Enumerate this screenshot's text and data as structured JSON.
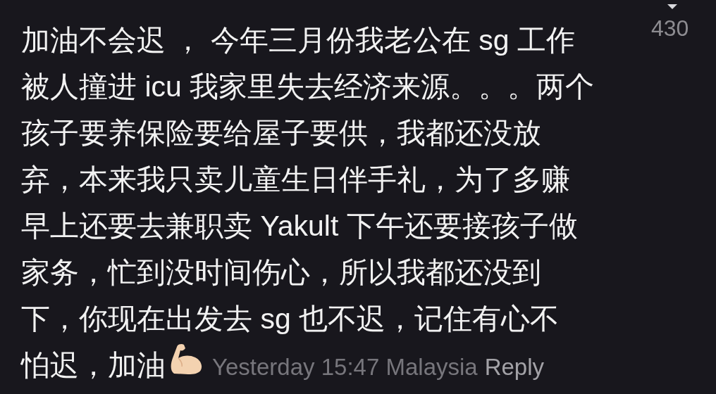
{
  "comment": {
    "lines": [
      "加油不会迟 ， 今年三月份我老公在 sg 工作",
      "被人撞进 icu 我家里失去经济来源。。。两个",
      "孩子要养保险要给屋子要供，我都还没放",
      "弃，本来我只卖儿童生日伴手礼，为了多赚",
      "早上还要去兼职卖 Yakult 下午还要接孩子做",
      "家务，忙到没时间伤心，所以我都还没到",
      "下，你现在出发去 sg 也不迟，记住有心不",
      "怕迟，加油"
    ],
    "meta": "Yesterday 15:47 Malaysia",
    "reply": "Reply",
    "likes": "430"
  }
}
